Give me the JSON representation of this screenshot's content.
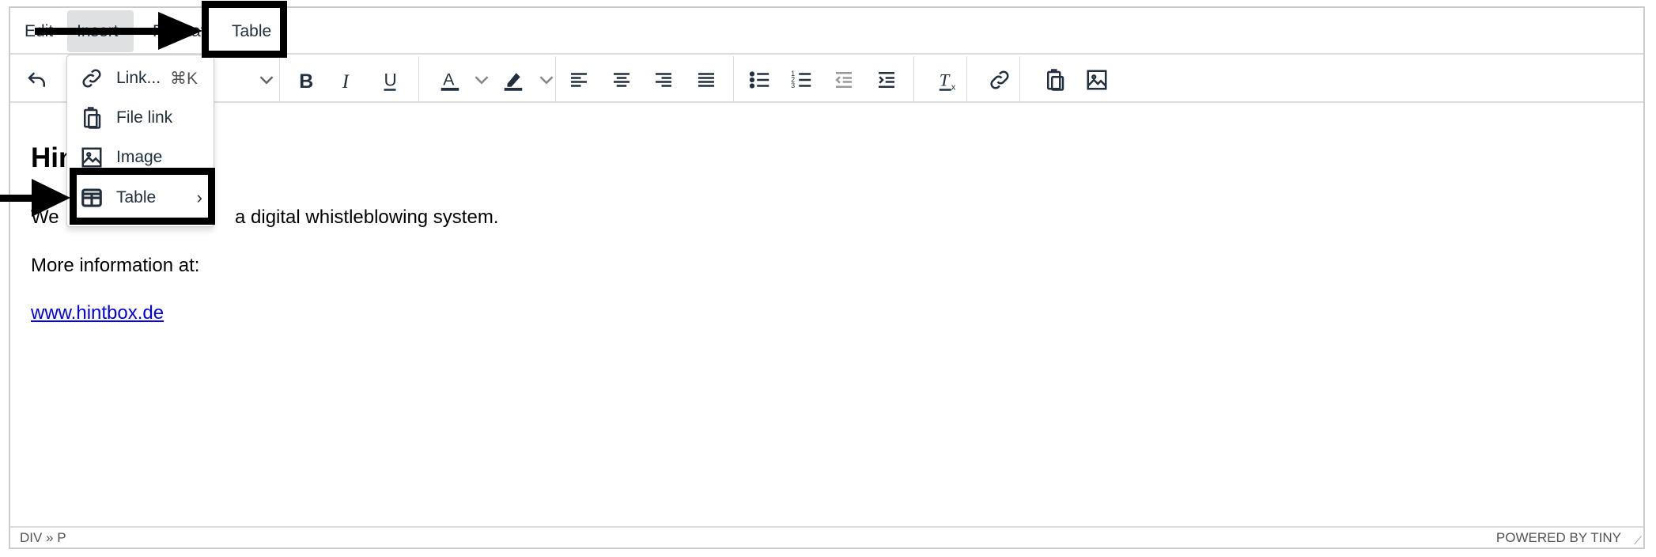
{
  "menubar": {
    "items": [
      {
        "label": "Edit"
      },
      {
        "label": "Insert",
        "active": true
      },
      {
        "label": "Format"
      },
      {
        "label": "Table"
      }
    ]
  },
  "toolbar": {
    "buttons": [
      "undo-icon",
      "blocks-dropdown",
      "bold-icon",
      "italic-icon",
      "underline-icon",
      "text-color-icon",
      "highlight-icon",
      "align-left-icon",
      "align-center-icon",
      "align-right-icon",
      "justify-icon",
      "bullet-list-icon",
      "numbered-list-icon",
      "outdent-icon",
      "indent-icon",
      "clear-format-icon",
      "link-icon",
      "paste-icon",
      "image-icon"
    ]
  },
  "content": {
    "heading": "Hin",
    "paragraph": "We ... a digital whistleblowing system.",
    "paragraph_visible_start": "We",
    "paragraph_visible_end": "a digital whistleblowing system.",
    "more_info": "More information at:",
    "link": "www.hintbox.de"
  },
  "insert_menu": {
    "items": [
      {
        "label": "Link...",
        "shortcut": "⌘K",
        "icon": "link-icon"
      },
      {
        "label": "File link",
        "icon": "clipboard-icon"
      },
      {
        "label": "Image",
        "icon": "image-icon"
      },
      {
        "label": "Table",
        "icon": "table-icon",
        "submenu": true
      }
    ]
  },
  "status": {
    "path": "DIV » P",
    "branding": "POWERED BY TINY"
  },
  "colors": {
    "accent": "#222f3e",
    "link": "#0000ee",
    "annotation": "#000000"
  }
}
